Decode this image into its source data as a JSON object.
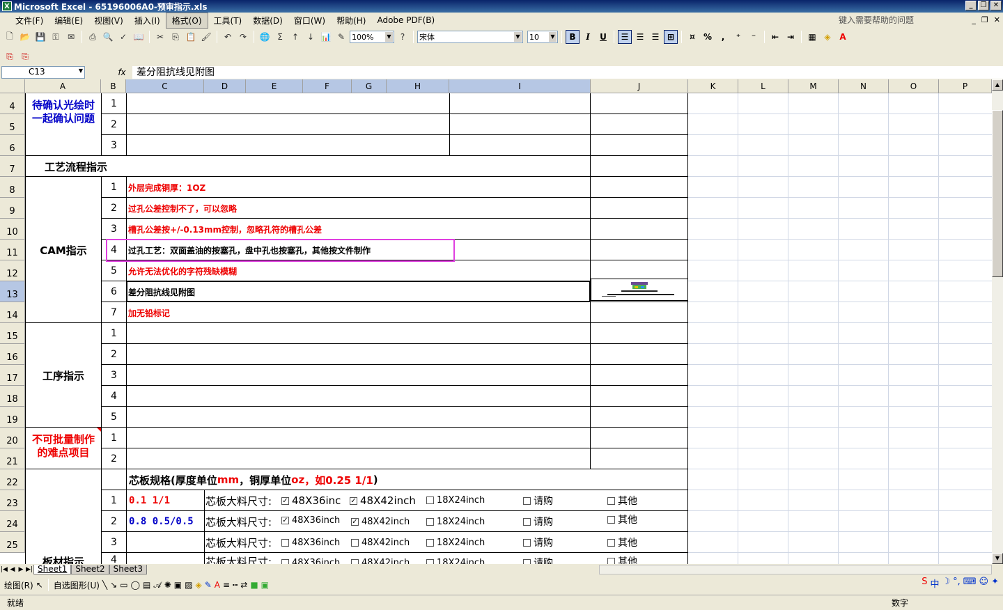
{
  "window": {
    "title": "Microsoft Excel - 65196006A0-预审指示.xls"
  },
  "menu": {
    "items": [
      "文件(F)",
      "编辑(E)",
      "视图(V)",
      "插入(I)",
      "格式(O)",
      "工具(T)",
      "数据(D)",
      "窗口(W)",
      "帮助(H)",
      "Adobe PDF(B)"
    ],
    "help_placeholder": "键入需要帮助的问题"
  },
  "toolbar": {
    "zoom": "100%",
    "font": "宋体",
    "size": "10",
    "bold": "B",
    "italic": "I",
    "underline": "U",
    "percent": "%",
    "comma": ","
  },
  "formula": {
    "cell_ref": "C13",
    "fx": "fx",
    "content": "差分阻抗线见附图"
  },
  "columns": [
    "A",
    "B",
    "C",
    "D",
    "E",
    "F",
    "G",
    "H",
    "I",
    "J",
    "K",
    "L",
    "M",
    "N",
    "O",
    "P"
  ],
  "rows": [
    "4",
    "5",
    "6",
    "7",
    "8",
    "9",
    "10",
    "11",
    "12",
    "13",
    "14",
    "15",
    "16",
    "17",
    "18",
    "19",
    "20",
    "21",
    "22",
    "23",
    "24",
    "25"
  ],
  "sections": {
    "confirm": "待确认光绘时\n一起确认问题",
    "process": "工艺流程指示",
    "cam": "CAM指示",
    "procedure": "工序指示",
    "difficult": "不可批量制作\n的难点项目",
    "material": "板材指示"
  },
  "nums": {
    "n1": "1",
    "n2": "2",
    "n3": "3",
    "n4": "4",
    "n5": "5",
    "n6": "6",
    "n7": "7"
  },
  "cam_items": [
    "外层完成铜厚：1OZ",
    "过孔公差控制不了，可以忽略",
    "槽孔公差按+/-0.13mm控制，忽略孔符的槽孔公差",
    "过孔工艺：双面盖油的按塞孔，盘中孔也按塞孔，其他按文件制作",
    "允许无法优化的字符残缺模糊",
    "差分阻抗线见附图",
    "加无铅标记"
  ],
  "core": {
    "header_a": "芯板规格(厚度单位",
    "header_b": "mm",
    "header_c": "，铜厚单位",
    "header_d": "oz",
    "header_e": "，如0.25 1/1",
    "header_f": ")",
    "spec1": "0.1 1/1",
    "spec2": "0.8 0.5/0.5",
    "size_label": "芯板大料尺寸:",
    "opt1": "48X36inc",
    "opt1b": "48X36inch",
    "opt2": "48X42inch",
    "opt3": "18X24inch",
    "opt4": "请购",
    "opt5": "其他"
  },
  "sheets": [
    "Sheet1",
    "Sheet2",
    "Sheet3"
  ],
  "drawbar": {
    "draw": "绘图(R)",
    "autoshape": "自选图形(U)"
  },
  "status": {
    "ready": "就绪",
    "num": "数字"
  },
  "ime": {
    "label": "中"
  }
}
